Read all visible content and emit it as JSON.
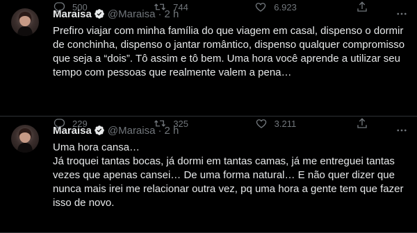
{
  "colors": {
    "background": "#000000",
    "text_primary": "#e7e9ea",
    "text_secondary": "#71767b",
    "verified": "#e7e9ea",
    "divider": "#2f3336"
  },
  "tweets": [
    {
      "name": "Maraisa",
      "handle": "@Maraisa",
      "separator": "·",
      "time": "2 h",
      "text": "Prefiro viajar com minha família do que viagem em casal, dispenso o dormir de conchinha, dispenso o jantar romântico, dispenso qualquer compromisso que seja a “dois”. Tô assim e tô bem. Uma hora você aprende a utilizar seu tempo com pessoas que realmente valem a pena…",
      "replies": "500",
      "retweets": "744",
      "likes": "6.923",
      "icons": [
        "verified-icon",
        "more-icon",
        "reply-icon",
        "retweet-icon",
        "like-icon",
        "share-icon"
      ]
    },
    {
      "name": "Maraisa",
      "handle": "@Maraisa",
      "separator": "·",
      "time": "2 h",
      "text": "Uma hora cansa…\nJá troquei tantas bocas, já dormi em tantas camas, já me entreguei tantas vezes que apenas cansei… De uma forma natural… E não quer dizer que nunca mais irei me relacionar outra vez, pq uma hora a gente tem que fazer isso de novo.",
      "replies": "229",
      "retweets": "325",
      "likes": "3.211",
      "icons": [
        "verified-icon",
        "more-icon",
        "reply-icon",
        "retweet-icon",
        "like-icon",
        "share-icon"
      ]
    }
  ]
}
